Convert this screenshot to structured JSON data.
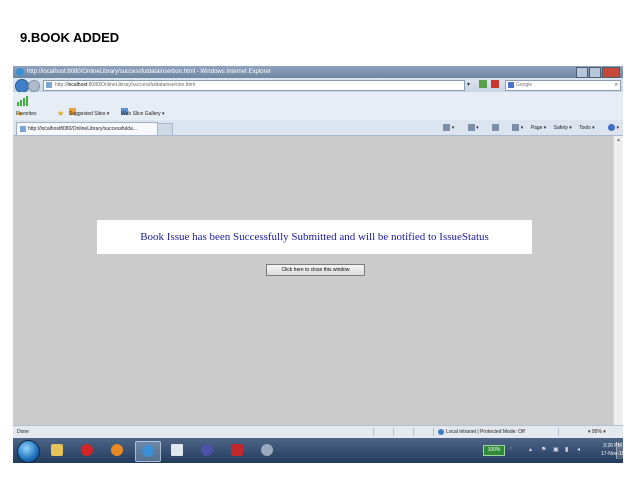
{
  "slide": {
    "title": "9.BOOK ADDED"
  },
  "window": {
    "title": "http://localhost:8080/OnlineLibrary/successfuldatainsertion.html - Windows Internet Explorer",
    "address_prefix": "http://",
    "address_host": "localhost",
    "address_rest": ":8080/OnlineLibrary/successfuldatainsertion.html",
    "search_placeholder": "Google"
  },
  "favorites": {
    "favorites_label": "Favorites",
    "suggested_label": "Suggested Sites ▾",
    "webslice_label": "Web Slice Gallery ▾"
  },
  "tab": {
    "label": "http://localhost8080/OnlineLibrary/successfulda..."
  },
  "commandbar": {
    "page_label": "Page ▾",
    "safety_label": "Safety ▾",
    "tools_label": "Tools ▾"
  },
  "content": {
    "message": "Book Issue has been Successfully Submitted and will be notified to IssueStatus",
    "close_button_label": "Click here to close this window"
  },
  "statusbar": {
    "left_text": "Done",
    "zone_text": "Local intranet | Protected Mode: Off",
    "zoom_text": "▾  95%  ▾"
  },
  "taskbar": {
    "language": "100%",
    "time": "3:26 PM",
    "date": "17-Nov-11"
  },
  "colors": {
    "message_text": "#1a1aa0",
    "content_bg": "#cbcbcb"
  }
}
